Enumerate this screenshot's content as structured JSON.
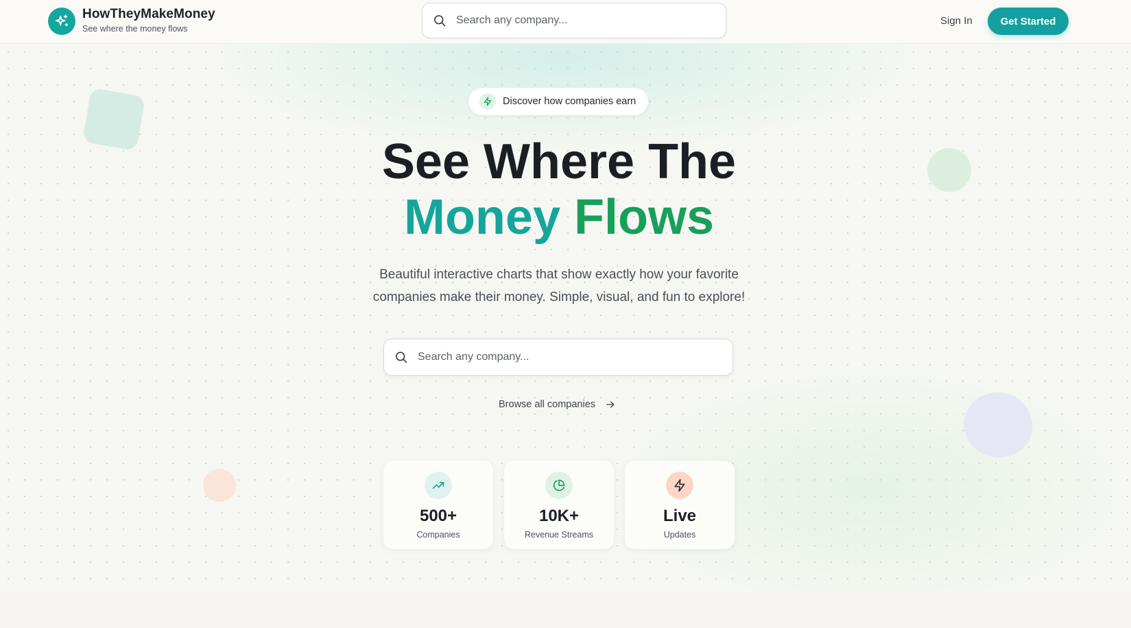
{
  "header": {
    "brand_name": "HowTheyMakeMoney",
    "brand_tagline": "See where the money flows",
    "logo_icon": "sparkles-icon",
    "search_placeholder": "Search any company...",
    "sign_in_label": "Sign In",
    "get_started_label": "Get Started"
  },
  "hero": {
    "badge_text": "Discover how companies earn",
    "badge_icon": "lightning-icon",
    "headline_line1": "See Where The",
    "headline_word_teal": "Money",
    "headline_word_green": "Flows",
    "subtext": "Beautiful interactive charts that show exactly how your favorite companies make their money. Simple, visual, and fun to explore!",
    "search_placeholder": "Search any company...",
    "browse_label": "Browse all companies"
  },
  "stats": [
    {
      "value": "500+",
      "label": "Companies",
      "icon": "trending-up-icon"
    },
    {
      "value": "10K+",
      "label": "Revenue Streams",
      "icon": "pie-chart-icon"
    },
    {
      "value": "Live",
      "label": "Updates",
      "icon": "lightning-icon"
    }
  ],
  "colors": {
    "brand_teal": "#14a0a0",
    "accent_green": "#17a05b",
    "heading_dark": "#1b1f24",
    "stat_icon_bg_teal": "#dff2ef",
    "stat_icon_bg_green": "#dff2e4",
    "stat_icon_bg_peach": "#fbd6c7"
  }
}
